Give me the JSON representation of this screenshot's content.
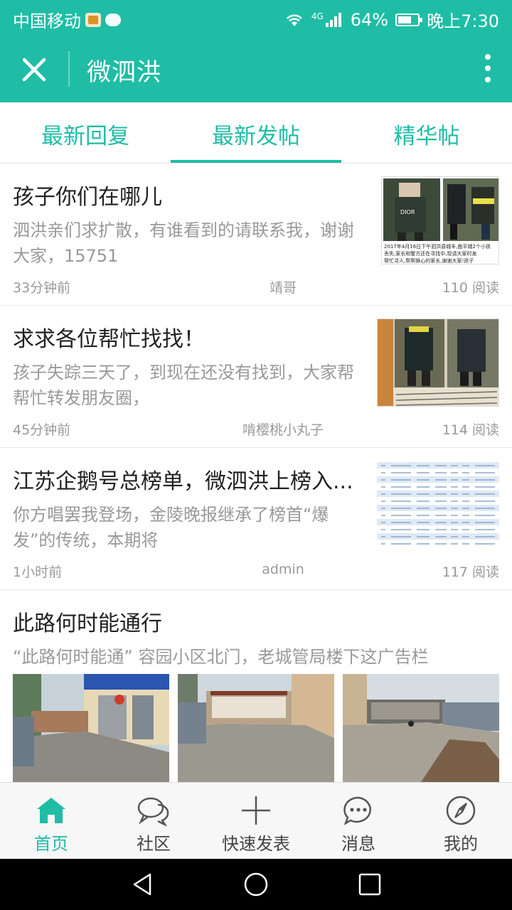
{
  "status_bar": {
    "carrier": "中国移动",
    "network": "4G",
    "battery": "64%",
    "time": "晚上7:30"
  },
  "app_bar": {
    "title": "微泗洪",
    "close_icon": "close-icon",
    "more_icon": "more-vertical-icon"
  },
  "tabs": [
    {
      "label": "最新回复",
      "active": false
    },
    {
      "label": "最新发帖",
      "active": true
    },
    {
      "label": "精华帖",
      "active": false
    }
  ],
  "posts": [
    {
      "title": "孩子你们在哪儿",
      "excerpt": "泗洪亲们求扩散，有谁看到的请联系我，谢谢大家，15751",
      "time": "33分钟前",
      "author": "靖哥",
      "reads": "110 阅读",
      "thumb_caption": "2017年4月16日下午泗洪县城丰，曲平城2个小孩丢失，家长和警方还在寻找中，现请大家时发帮忙寻人，帮帮揪心的家长，谢谢大家！孩子"
    },
    {
      "title": "求求各位帮忙找找！",
      "excerpt": "孩子失踪三天了，到现在还没有找到，大家帮帮忙转发朋友圈，",
      "time": "45分钟前",
      "author": "啃樱桃小丸子",
      "reads": "114 阅读"
    },
    {
      "title": "江苏企鹅号总榜单，微泗洪上榜入...",
      "excerpt": "你方唱罢我登场，金陵晚报继承了榜首“爆发”的传统，本期将",
      "time": "1小时前",
      "author": "admin",
      "reads": "117 阅读"
    },
    {
      "title": "此路何时能通行",
      "excerpt": "“此路何时能通” 容园小区北门，老城管局楼下这广告栏"
    }
  ],
  "bottom_nav": [
    {
      "label": "首页",
      "icon": "home-icon",
      "active": true
    },
    {
      "label": "社区",
      "icon": "community-chat-icon",
      "active": false
    },
    {
      "label": "快速发表",
      "icon": "plus-icon",
      "active": false
    },
    {
      "label": "消息",
      "icon": "message-icon",
      "active": false
    },
    {
      "label": "我的",
      "icon": "compass-icon",
      "active": false
    }
  ],
  "colors": {
    "accent": "#1fbda6",
    "text_primary": "#222222",
    "text_secondary": "#999999"
  }
}
